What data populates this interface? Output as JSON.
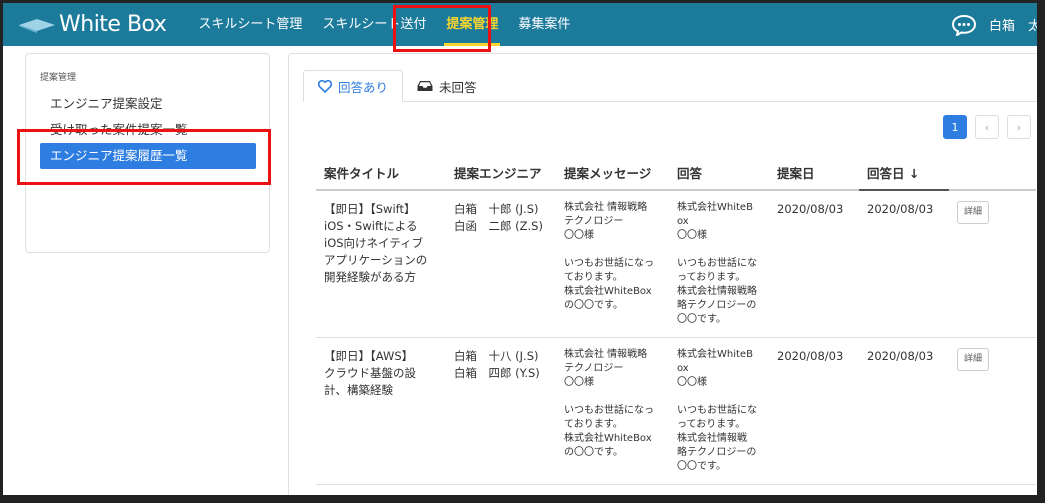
{
  "header": {
    "logo_text": "White Box",
    "nav": [
      {
        "label": "スキルシート管理"
      },
      {
        "label": "スキルシート送付"
      },
      {
        "label": "提案管理"
      },
      {
        "label": "募集案件"
      }
    ],
    "user_name": "白箱　太郎"
  },
  "sidebar": {
    "heading": "提案管理",
    "items": [
      {
        "label": "エンジニア提案設定"
      },
      {
        "label": "受け取った案件提案一覧"
      },
      {
        "label": "エンジニア提案履歴一覧"
      }
    ]
  },
  "tabs": [
    {
      "label": "回答あり",
      "icon": "heart-icon"
    },
    {
      "label": "未回答",
      "icon": "inbox-icon"
    }
  ],
  "pager": {
    "current": "1",
    "prev": "‹",
    "next": "›"
  },
  "table": {
    "headers": [
      "案件タイトル",
      "提案エンジニア",
      "提案メッセージ",
      "回答",
      "提案日",
      "回答日 ↓"
    ],
    "rows": [
      {
        "title": "【即日】【Swift】\niOS・Swiftによる\niOS向けネイティブ\nアプリケーションの\n開発経験がある方",
        "engineers": "白箱　十郎 (J.S)\n白函　二郎 (Z.S)",
        "message": "株式会社 情報戦略\nテクノロジー\n〇〇様\n\nいつもお世話になっ\nております。\n株式会社WhiteBox\nの〇〇です。",
        "reply": "株式会社WhiteB\nox\n〇〇様\n\nいつもお世話にな\nっております。\n株式会社情報戦略\n略テクノロジーの\n〇〇です。",
        "proposal_date": "2020/08/03",
        "reply_date": "2020/08/03",
        "detail": "詳細"
      },
      {
        "title": "【即日】【AWS】\nクラウド基盤の設\n計、構築経験",
        "engineers": "白箱　十八 (J.S)\n白箱　四郎 (Y.S)",
        "message": "株式会社 情報戦略\nテクノロジー\n〇〇様\n\nいつもお世話になっ\nております。\n株式会社WhiteBox\nの〇〇です。",
        "reply": "株式会社WhiteB\nox\n〇〇様\n\nいつもお世話にな\nっております。\n株式会社情報戦\n略テクノロジーの\n〇〇です。",
        "proposal_date": "2020/08/03",
        "reply_date": "2020/08/03",
        "detail": "詳細"
      }
    ]
  },
  "colors": {
    "nav_bg": "#1c7a9b",
    "nav_active": "#f5d430",
    "accent": "#2e7de0",
    "highlight": "#ee1111"
  }
}
